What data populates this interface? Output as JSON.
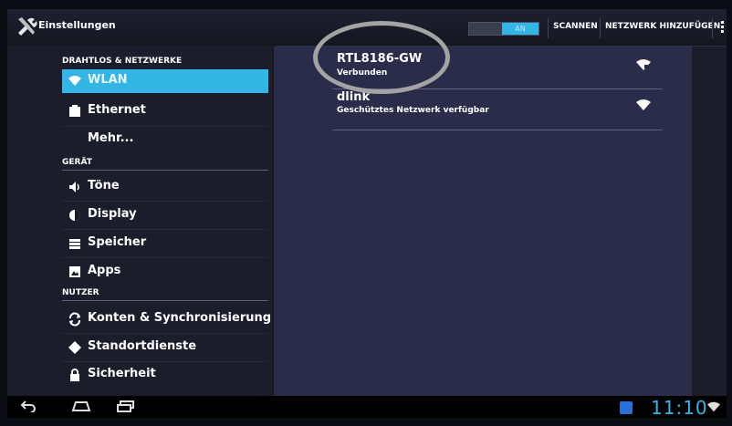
{
  "actionbar": {
    "title": "Einstellungen",
    "wifi_toggle_label": "AN",
    "scan_label": "SCANNEN",
    "add_network_label": "NETZWERK HINZUFÜGEN",
    "accent": "#33b5e5"
  },
  "sidebar": {
    "header_wireless": "DRAHTLOS & NETZWERKE",
    "header_device": "GERÄT",
    "header_user": "NUTZER",
    "items": [
      {
        "label": "WLAN",
        "icon": "wifi-icon",
        "selected": true
      },
      {
        "label": "Ethernet",
        "icon": "ethernet-icon",
        "selected": false
      },
      {
        "label": "Mehr...",
        "icon": "",
        "selected": false
      },
      {
        "label": "Töne",
        "icon": "speaker-icon",
        "selected": false
      },
      {
        "label": "Display",
        "icon": "brightness-icon",
        "selected": false
      },
      {
        "label": "Speicher",
        "icon": "storage-icon",
        "selected": false
      },
      {
        "label": "Apps",
        "icon": "apps-icon",
        "selected": false
      },
      {
        "label": "Konten & Synchronisierung",
        "icon": "sync-icon",
        "selected": false
      },
      {
        "label": "Standortdienste",
        "icon": "location-icon",
        "selected": false
      },
      {
        "label": "Sicherheit",
        "icon": "lock-icon",
        "selected": false
      }
    ]
  },
  "networks": [
    {
      "name": "RTL8186-GW",
      "status": "Verbunden"
    },
    {
      "name": "dlink",
      "status": "Geschütztes Netzwerk verfügbar"
    }
  ],
  "statusbar": {
    "time": "11:10"
  }
}
